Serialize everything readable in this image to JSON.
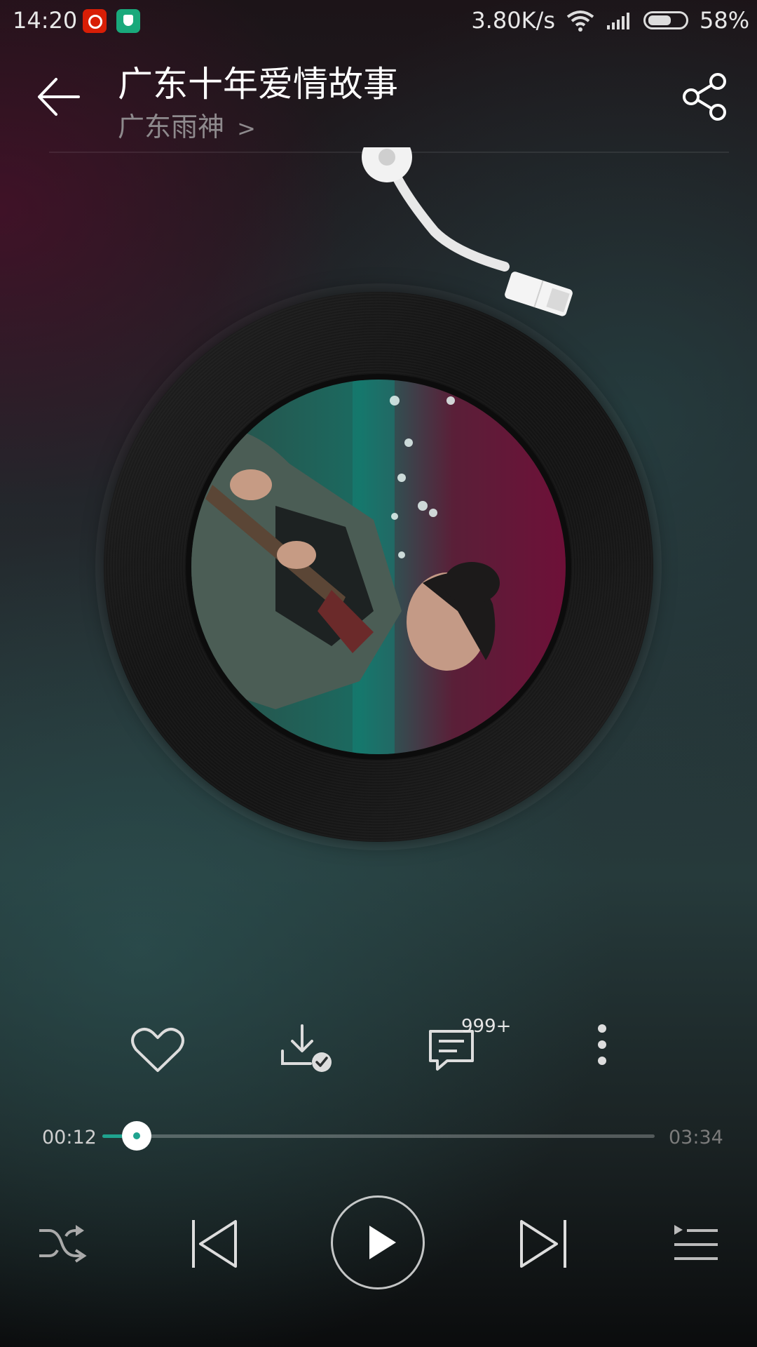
{
  "status_bar": {
    "time": "14:20",
    "net_speed": "3.80K/s",
    "battery": "58%"
  },
  "header": {
    "title": "广东十年爱情故事",
    "artist": "广东雨神",
    "artist_chevron": ">"
  },
  "actions": {
    "comment_count": "999+"
  },
  "player": {
    "current_time": "00:12",
    "total_time": "03:34",
    "progress": 0.0625
  },
  "colors": {
    "accent": "#1fa38f",
    "brand_netease": "#d81e06"
  },
  "icons": [
    "netease-cloud-music-icon",
    "shield-app-icon",
    "wifi-icon",
    "signal-icon",
    "battery-icon",
    "back-arrow-icon",
    "share-icon",
    "heart-icon",
    "download-done-icon",
    "comment-icon",
    "more-vertical-icon",
    "shuffle-icon",
    "previous-icon",
    "play-icon",
    "next-icon",
    "playlist-icon"
  ]
}
